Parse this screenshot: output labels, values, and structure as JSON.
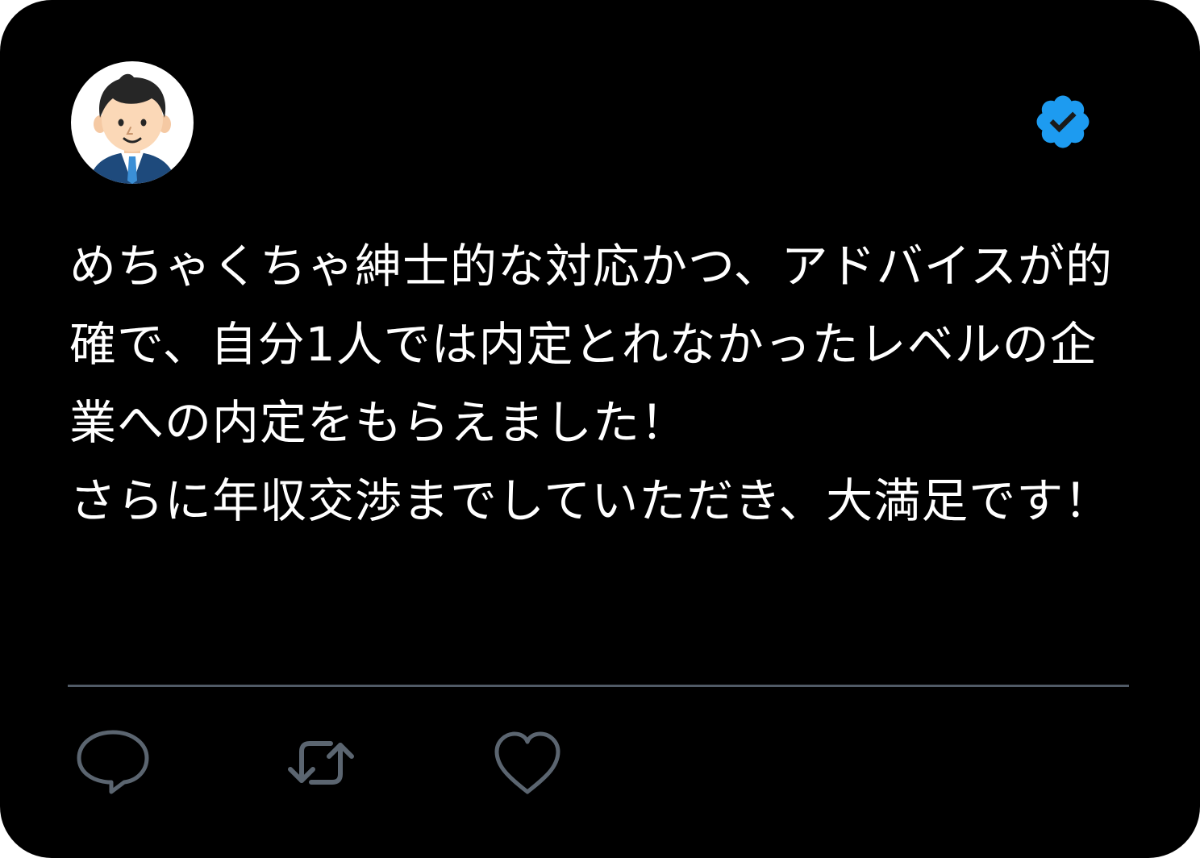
{
  "tweet": {
    "text": "めちゃくちゃ紳士的な対応かつ、アドバイスが的確で、自分1人では内定とれなかったレベルの企業への内定をもらえました！\nさらに年収交渉までしていただき、大満足です！",
    "verified": true
  },
  "icons": {
    "avatar": "businessman-avatar-icon",
    "verified": "verified-badge-icon",
    "reply": "reply-icon",
    "retweet": "retweet-icon",
    "like": "heart-icon"
  },
  "colors": {
    "background": "#000000",
    "text": "#ffffff",
    "verified": "#1d9bf0",
    "icon": "#5b6570",
    "divider": "#505a66"
  }
}
